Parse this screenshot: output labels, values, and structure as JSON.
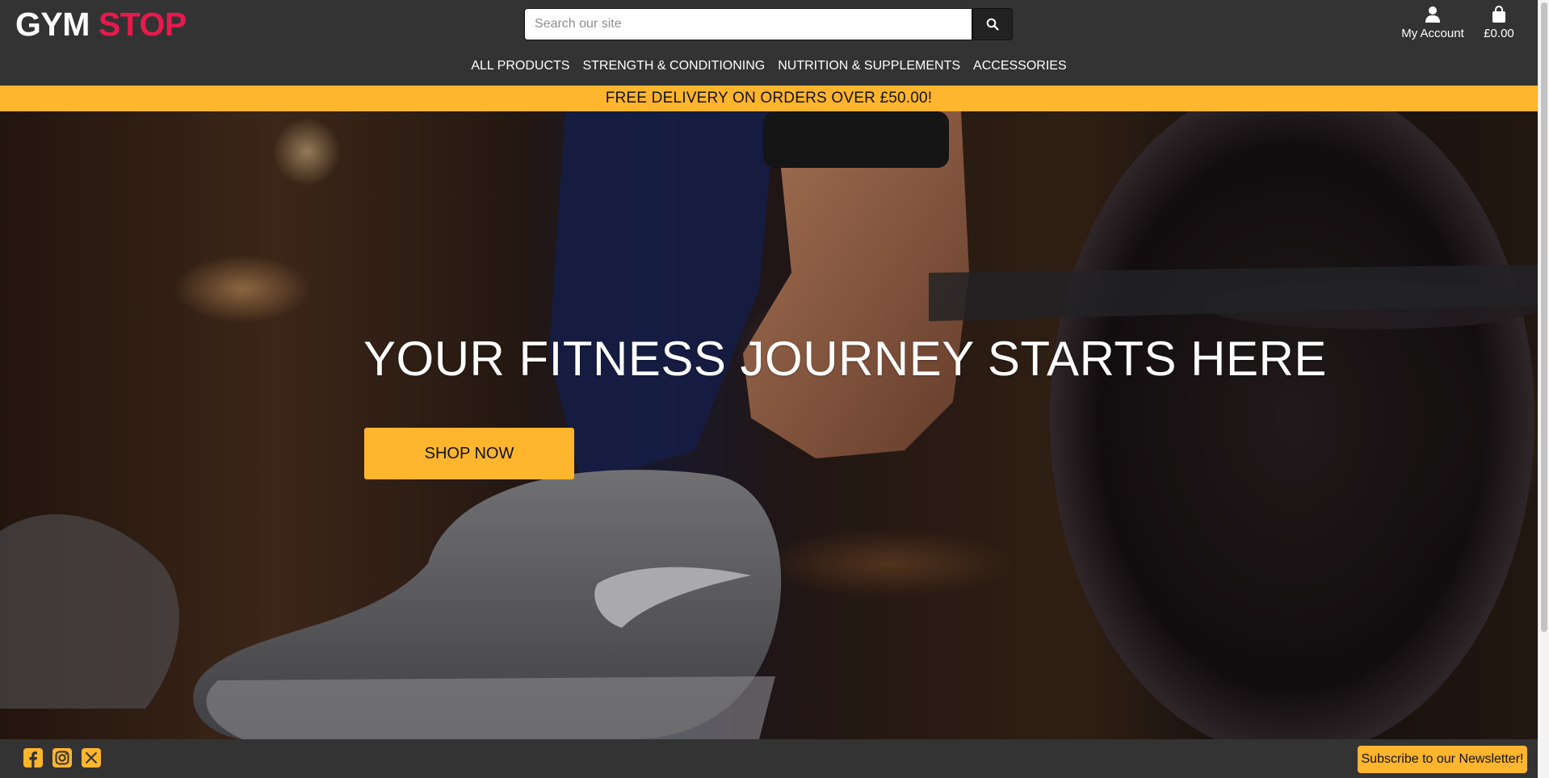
{
  "header": {
    "logo": {
      "part1": "GYM",
      "part2": "STOP"
    },
    "search": {
      "placeholder": "Search our site",
      "value": "",
      "button_icon": "search-icon"
    },
    "account": {
      "label": "My Account",
      "icon": "user-icon"
    },
    "bag": {
      "label": "£0.00",
      "icon": "shopping-bag-icon"
    },
    "nav": [
      {
        "label": "ALL PRODUCTS"
      },
      {
        "label": "STRENGTH & CONDITIONING"
      },
      {
        "label": "NUTRITION & SUPPLEMENTS"
      },
      {
        "label": "ACCESSORIES"
      }
    ]
  },
  "banner": {
    "text": "FREE DELIVERY ON ORDERS OVER £50.00!"
  },
  "hero": {
    "title": "YOUR FITNESS JOURNEY STARTS HERE",
    "button_label": "SHOP NOW"
  },
  "footer": {
    "social": [
      {
        "icon": "facebook-icon"
      },
      {
        "icon": "instagram-icon"
      },
      {
        "icon": "x-twitter-icon"
      }
    ],
    "newsletter_label": "Subscribe to our Newsletter!"
  },
  "colors": {
    "accent": "#ffb52e",
    "brand_red": "#e8194d",
    "header_bg": "#333333"
  }
}
